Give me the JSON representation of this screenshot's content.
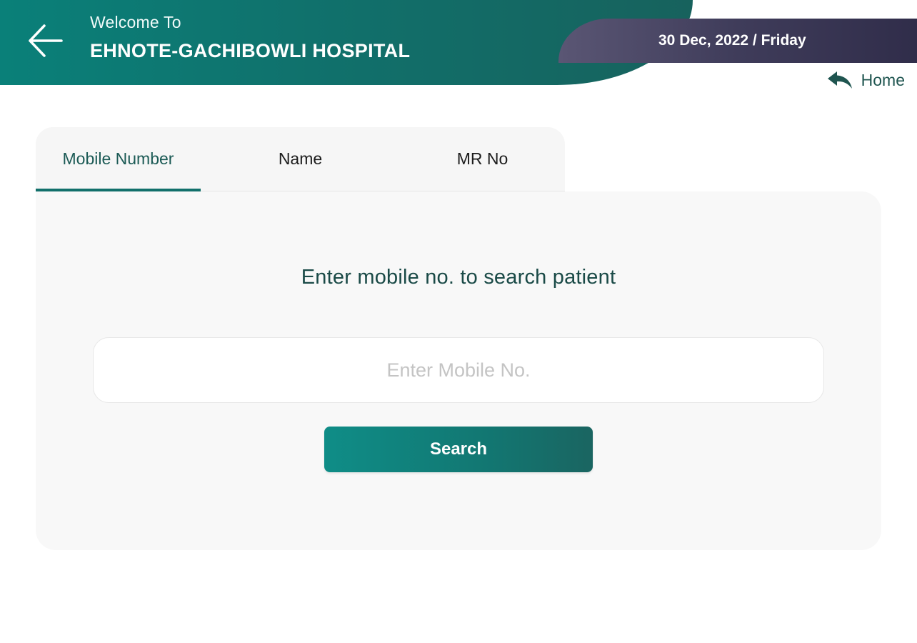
{
  "header": {
    "welcome_text": "Welcome To",
    "hospital_name": "EHNOTE-GACHIBOWLI HOSPITAL",
    "date_text": "30 Dec, 2022 / Friday",
    "home_label": "Home",
    "back_icon": "arrow-left-icon",
    "home_icon": "reply-arrow-icon"
  },
  "tabs": [
    {
      "label": "Mobile Number",
      "active": true
    },
    {
      "label": "Name",
      "active": false
    },
    {
      "label": "MR No",
      "active": false
    }
  ],
  "search": {
    "prompt": "Enter mobile no. to search patient",
    "placeholder": "Enter Mobile No.",
    "value": "",
    "button_label": "Search"
  },
  "colors": {
    "primary_teal": "#12706b",
    "date_bar": "#3f3c5a",
    "panel_bg": "#f8f8f8"
  }
}
